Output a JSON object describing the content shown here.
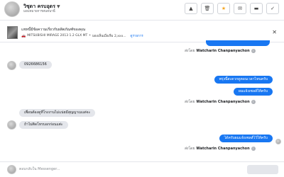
{
  "header": {
    "name": "วิชุดา ครบอุดร",
    "subtitle": "มอบหมายการสนทนานี้",
    "actions": [
      {
        "icon": "warning-icon",
        "glyph": "▲"
      },
      {
        "icon": "trash-icon",
        "glyph": "🗑"
      },
      {
        "icon": "star-icon",
        "glyph": "★"
      },
      {
        "icon": "mail-icon",
        "glyph": "✉"
      },
      {
        "icon": "snooze-icon",
        "glyph": "▬"
      },
      {
        "icon": "check-icon",
        "glyph": "✓"
      }
    ]
  },
  "banner": {
    "title": "แชทนี้มีข้อความเกี่ยวกับผลิตภัณฑ์ของคุณ",
    "car_glyph": "🚗",
    "product": "MITSUBISHI MIRAGE 2013 1.2 GLX MT",
    "separator": "•",
    "note": "มองเห็นเมื่อเริ่ม 2,xxx...",
    "link": "ดูรายการ"
  },
  "messages": {
    "sent_prefix": "ส่งโดย",
    "agent": "Watcharin Chanpanyachon",
    "info_glyph": "i",
    "in1": "0926686156",
    "out1": "พรุ่งนี้สะดวกดูตอนเวลาไหนครับ",
    "out2": "ผมแจ้งเซลส์ให้ครับ",
    "in2": "เพื่อนต้องดูที่โรงงานไม่แน่ยมีสุญญาเมแต่จะ",
    "in3": "ถ้าไม่ติดโทรบอกก่อนแต่ะ",
    "out3": "ได้ครับผมแจ้งเซลส์ไว้ให้ครับ"
  },
  "composer": {
    "placeholder": "ตอบกลับใน Messenger..."
  }
}
